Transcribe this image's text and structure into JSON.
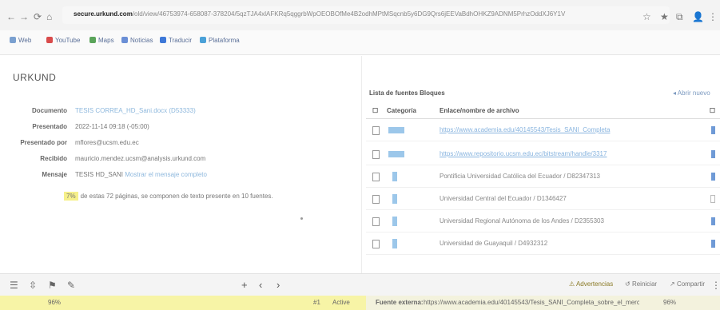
{
  "browser": {
    "nav": [
      "←",
      "→",
      "⟳",
      "⌂"
    ],
    "url_host": "secure.urkund.com",
    "url_rest": "/old/view/46753974-658087-378204/5qzTJA4xlAFKRq5qggrbWpOEOBOfMe4B2odhMPtMSqcnb5y6DG9Qrs6jEEVaBdhOHKZ9ADNM5PrhzOddXJ6Y1V",
    "toolbar_icons": [
      "☆",
      "★",
      "⧉",
      "👤",
      "⋮"
    ],
    "bookmarks": [
      {
        "label": "Web",
        "color": "#7aa0d0"
      },
      {
        "label": "YouTube",
        "color": "#d94b4b"
      },
      {
        "label": "Maps",
        "color": "#5aa45a"
      },
      {
        "label": "Noticias",
        "color": "#6b8fd6"
      },
      {
        "label": "Traducir",
        "color": "#3d78d8"
      },
      {
        "label": "Plataforma",
        "color": "#4aa1d8"
      }
    ]
  },
  "app": {
    "title": "URKUND",
    "meta": [
      {
        "label": "Documento",
        "value": "TESIS CORREA_HD_Sani.docx (D53333)",
        "link": true
      },
      {
        "label": "Presentado",
        "value": "2022-11-14 09:18 (-05:00)",
        "link": false
      },
      {
        "label": "Presentado por",
        "value": "mflores@ucsm.edu.ec",
        "link": false
      },
      {
        "label": "Recibido",
        "value": "mauricio.mendez.ucsm@analysis.urkund.com",
        "link": false
      },
      {
        "label": "Mensaje",
        "value": "TESIS HD_SANI",
        "extra": "Mostrar el mensaje completo",
        "link": false
      }
    ],
    "match": {
      "percent": "7%",
      "text": "de estas 72 páginas, se componen de texto presente en 10 fuentes."
    }
  },
  "sources": {
    "header": "Lista de fuentes  Bloques",
    "back": "◂ Abrir nuevo",
    "columns": [
      "Categoría",
      "Enlace/nombre de archivo"
    ],
    "rows": [
      {
        "icon": "wide",
        "name": "https://www.academia.edu/40145543/Tesis_SANI_Completa",
        "link": true,
        "end": "filled"
      },
      {
        "icon": "wide",
        "name": "https://www.repositorio.ucsm.edu.ec/bitstream/handle/3317",
        "link": true,
        "end": "filled"
      },
      {
        "icon": "narrow",
        "name": "Pontificia Universidad Católica del Ecuador / D82347313",
        "link": false,
        "end": "filled"
      },
      {
        "icon": "narrow",
        "name": "Universidad Central del Ecuador / D1346427",
        "link": false,
        "end": "empty"
      },
      {
        "icon": "narrow",
        "name": "Universidad Regional Autónoma de los Andes / D2355303",
        "link": false,
        "end": "filled"
      },
      {
        "icon": "narrow",
        "name": "Universidad de Guayaquil / D4932312",
        "link": false,
        "end": "filled"
      }
    ]
  },
  "bottom": {
    "tools": [
      "☰",
      "⇳",
      "⚑",
      "✎"
    ],
    "arrows": [
      "+",
      "‹",
      "›"
    ],
    "buttons": [
      "Advertencias",
      "Reiniciar",
      "Compartir"
    ],
    "more": "⋮"
  },
  "status": {
    "left": "96%",
    "page": "#1",
    "count": "Active",
    "source_label": "Fuente externa:",
    "source_value": "https://www.academia.edu/40145543/Tesis_SANI_Completa_sobre_el_mercado_de_la_provincia",
    "right": "96%"
  }
}
